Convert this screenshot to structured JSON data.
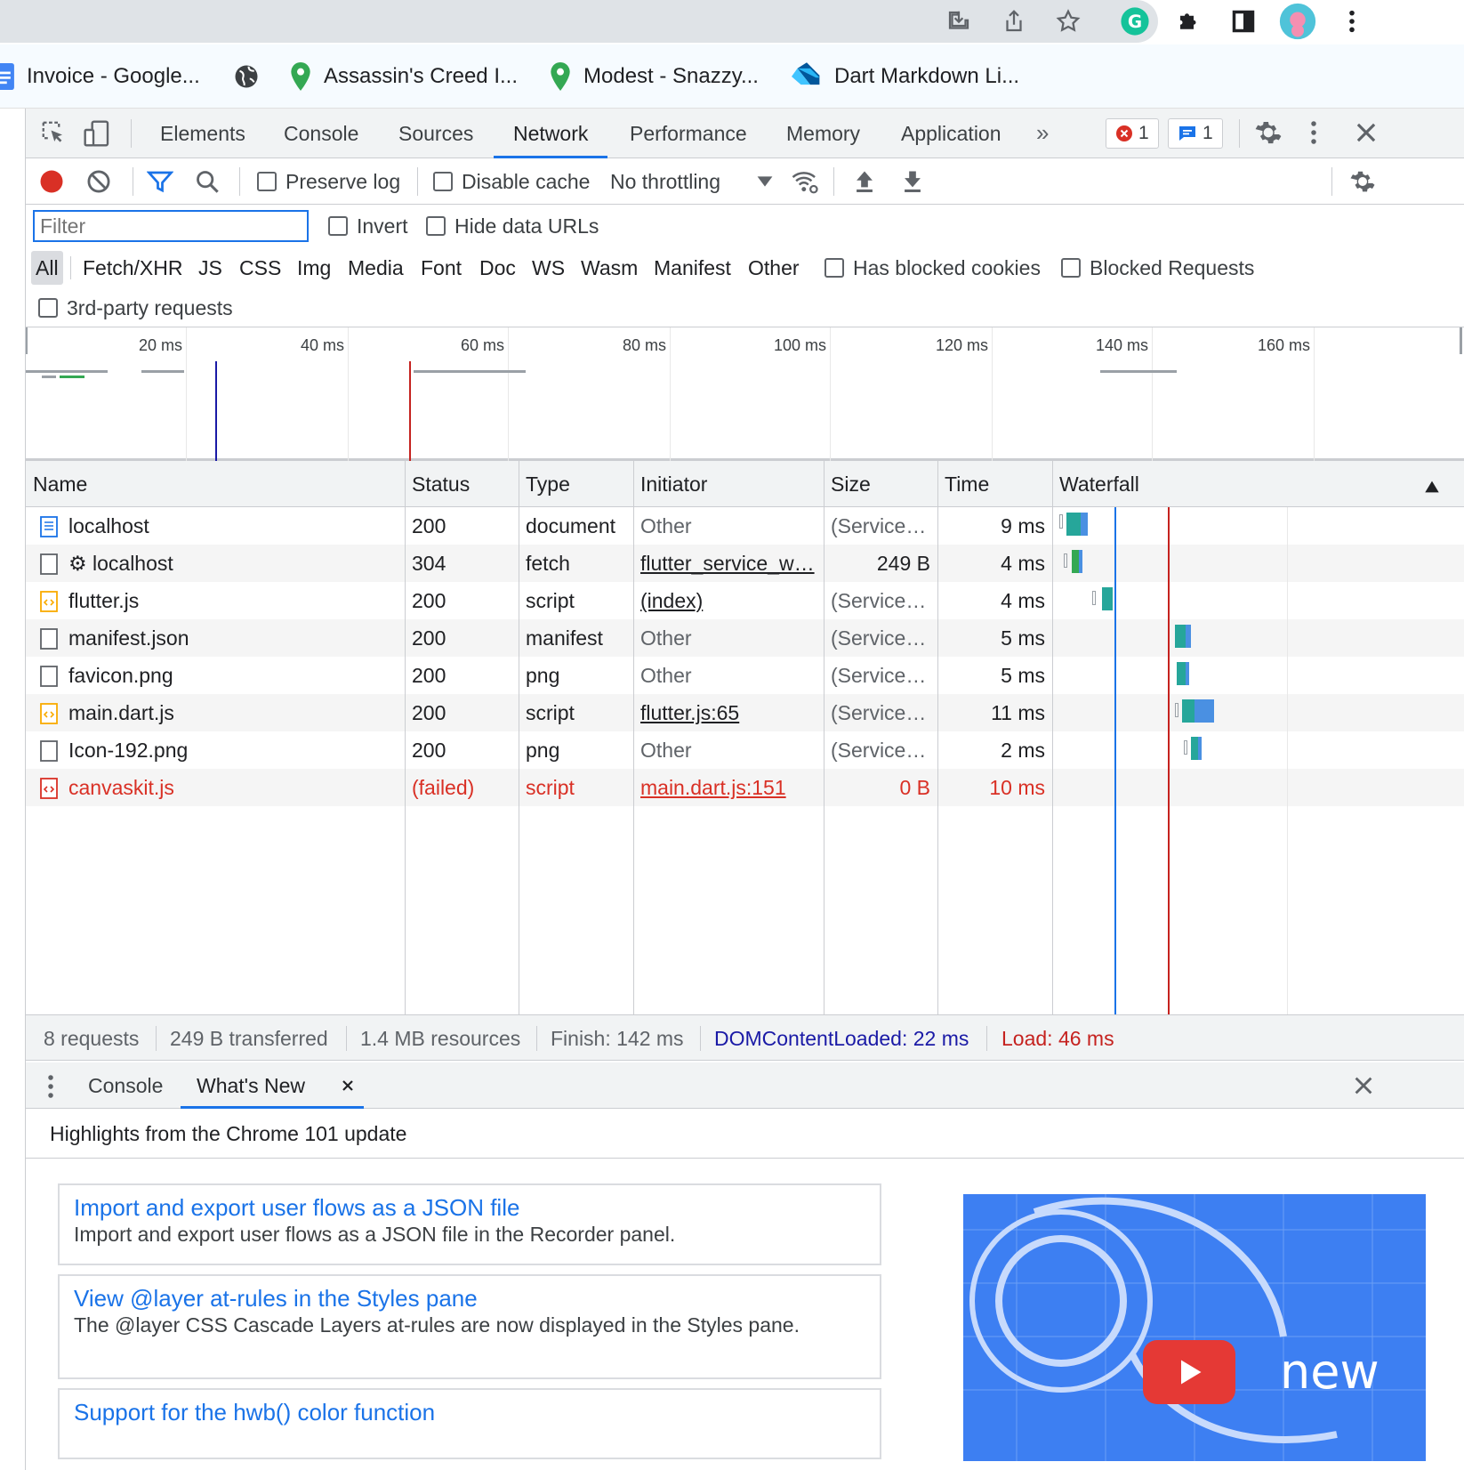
{
  "bookmarks": [
    {
      "label": "Invoice - Google..."
    },
    {
      "label": ""
    },
    {
      "label": "Assassin's Creed I..."
    },
    {
      "label": "Modest - Snazzy..."
    },
    {
      "label": "Dart Markdown Li..."
    }
  ],
  "devtools": {
    "tabs": [
      "Elements",
      "Console",
      "Sources",
      "Network",
      "Performance",
      "Memory",
      "Application"
    ],
    "active_tab": "Network",
    "error_count": "1",
    "message_count": "1"
  },
  "network_toolbar": {
    "preserve_log": "Preserve log",
    "disable_cache": "Disable cache",
    "throttling": "No throttling"
  },
  "filter": {
    "placeholder": "Filter",
    "invert": "Invert",
    "hide_data_urls": "Hide data URLs",
    "types": [
      "All",
      "Fetch/XHR",
      "JS",
      "CSS",
      "Img",
      "Media",
      "Font",
      "Doc",
      "WS",
      "Wasm",
      "Manifest",
      "Other"
    ],
    "has_blocked_cookies": "Has blocked cookies",
    "blocked_requests": "Blocked Requests",
    "third_party": "3rd-party requests"
  },
  "overview": {
    "ticks": [
      "20 ms",
      "40 ms",
      "60 ms",
      "80 ms",
      "100 ms",
      "120 ms",
      "140 ms",
      "160 ms"
    ]
  },
  "table": {
    "columns": [
      "Name",
      "Status",
      "Type",
      "Initiator",
      "Size",
      "Time",
      "Waterfall"
    ],
    "rows": [
      {
        "name": "localhost",
        "status": "200",
        "type": "document",
        "initiator": "Other",
        "size": "(Service…",
        "time": "9 ms"
      },
      {
        "name": "⚙ localhost",
        "status": "304",
        "type": "fetch",
        "initiator": "flutter_service_w…",
        "size": "249 B",
        "time": "4 ms"
      },
      {
        "name": "flutter.js",
        "status": "200",
        "type": "script",
        "initiator": "(index)",
        "size": "(Service…",
        "time": "4 ms"
      },
      {
        "name": "manifest.json",
        "status": "200",
        "type": "manifest",
        "initiator": "Other",
        "size": "(Service…",
        "time": "5 ms"
      },
      {
        "name": "favicon.png",
        "status": "200",
        "type": "png",
        "initiator": "Other",
        "size": "(Service…",
        "time": "5 ms"
      },
      {
        "name": "main.dart.js",
        "status": "200",
        "type": "script",
        "initiator": "flutter.js:65",
        "size": "(Service…",
        "time": "11 ms"
      },
      {
        "name": "Icon-192.png",
        "status": "200",
        "type": "png",
        "initiator": "Other",
        "size": "(Service…",
        "time": "2 ms"
      },
      {
        "name": "canvaskit.js",
        "status": "(failed)",
        "type": "script",
        "initiator": "main.dart.js:151",
        "size": "0 B",
        "time": "10 ms"
      }
    ]
  },
  "summary": {
    "requests": "8 requests",
    "transferred": "249 B transferred",
    "resources": "1.4 MB resources",
    "finish": "Finish: 142 ms",
    "dom_content_loaded": "DOMContentLoaded: 22 ms",
    "load": "Load: 46 ms"
  },
  "drawer": {
    "tabs": [
      "Console",
      "What's New"
    ],
    "header": "Highlights from the Chrome 101 update",
    "cards": [
      {
        "title": "Import and export user flows as a JSON file",
        "desc": "Import and export user flows as a JSON file in the Recorder panel."
      },
      {
        "title": "View @layer at-rules in the Styles pane",
        "desc": "The @layer CSS Cascade Layers at-rules are now displayed in the Styles pane."
      },
      {
        "title": "Support for the hwb() color function",
        "desc": ""
      }
    ],
    "promo_text": "new"
  },
  "colors": {
    "accent": "#1a73e8",
    "error": "#d93025",
    "dcl_line": "#1a1aa6",
    "load_line": "#c5221f"
  }
}
